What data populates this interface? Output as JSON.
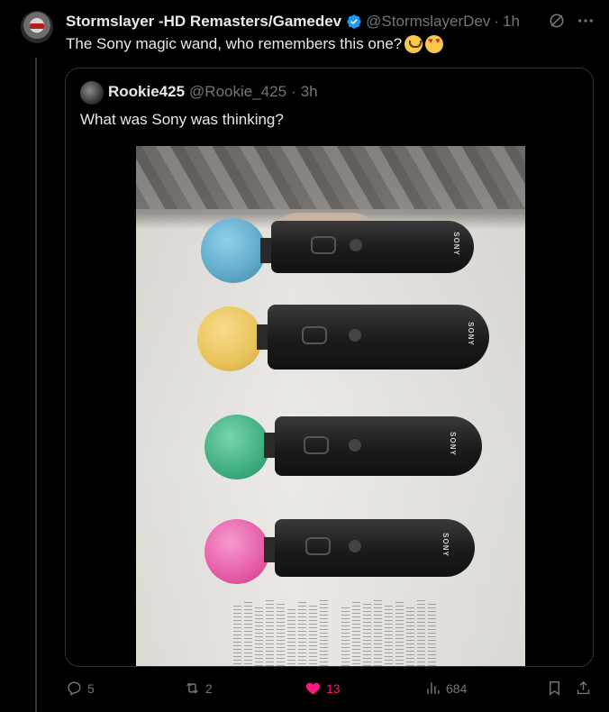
{
  "post": {
    "author_name": "Stormslayer -HD Remasters/Gamedev",
    "author_handle": "@StormslayerDev",
    "separator": "·",
    "time": "1h",
    "text": "The Sony magic wand, who remembers this one?",
    "emojis": [
      "face-holding-back-tears-emoji",
      "smiling-face-with-heart-eyes-emoji"
    ]
  },
  "quote": {
    "author_name": "Rookie425",
    "author_handle": "@Rookie_425",
    "separator": "·",
    "time": "3h",
    "text": "What was Sony was thinking?"
  },
  "photo": {
    "wand_colors": [
      "#5fa9c8",
      "#e8c35a",
      "#3fae7e",
      "#e65ca6"
    ],
    "brand_label": "SONY"
  },
  "actions": {
    "replies": "5",
    "reposts": "2",
    "likes": "13",
    "views": "684"
  },
  "colors": {
    "background": "#000000",
    "text_primary": "#e7e9ea",
    "text_secondary": "#71767b",
    "like_active": "#f91880",
    "verified": "#1d9bf0",
    "border": "#2f3336"
  }
}
